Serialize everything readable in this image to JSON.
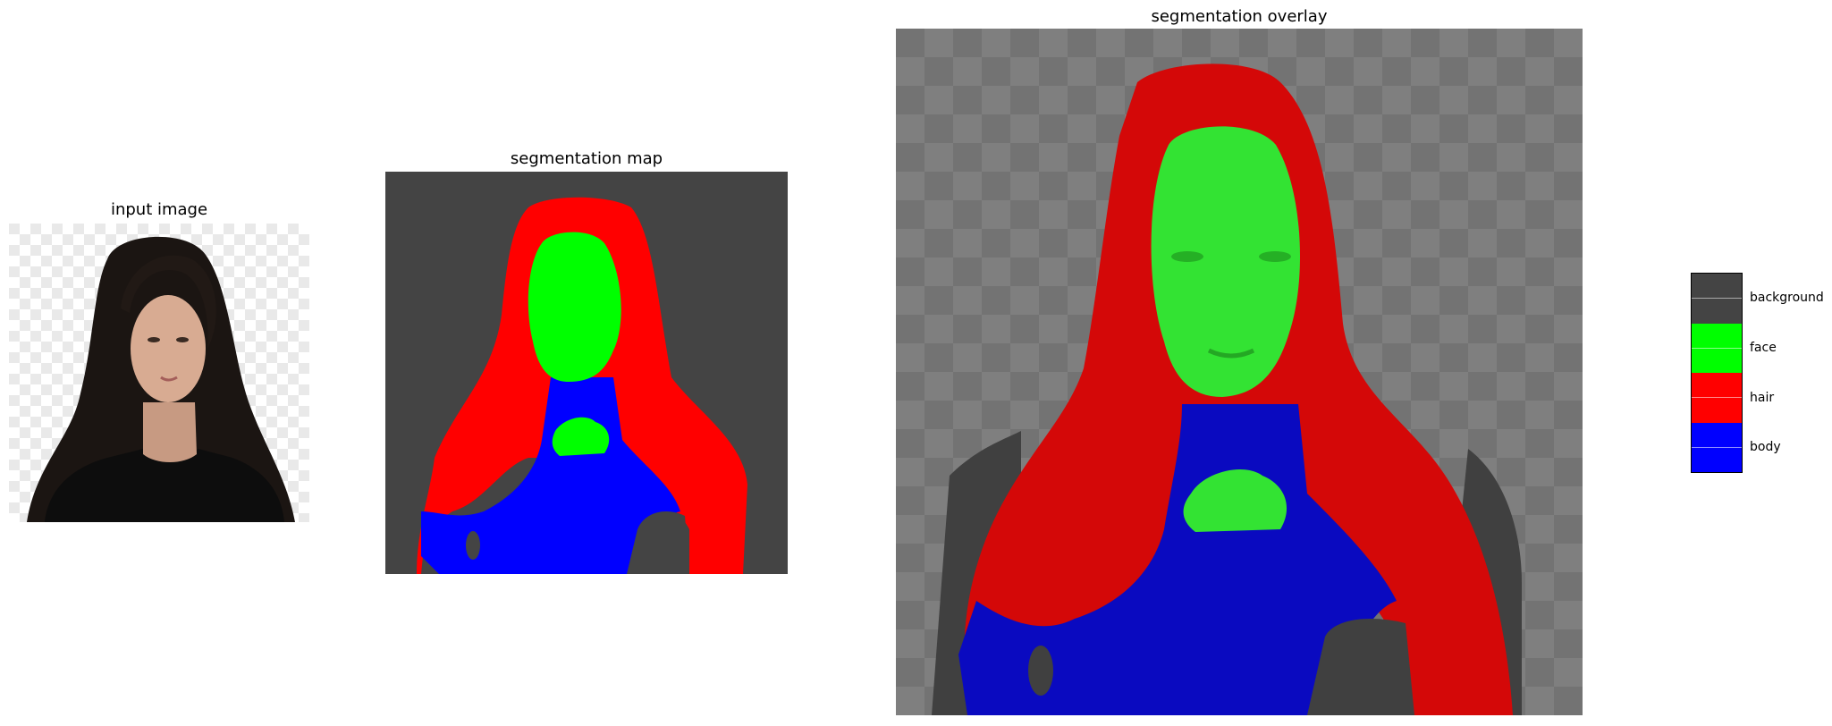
{
  "panels": {
    "input": {
      "title": "input image"
    },
    "map": {
      "title": "segmentation map"
    },
    "overlay": {
      "title": "segmentation overlay"
    }
  },
  "legend": {
    "items": [
      {
        "label": "background",
        "color": "#444444"
      },
      {
        "label": "face",
        "color": "#00ff00"
      },
      {
        "label": "hair",
        "color": "#ff0000"
      },
      {
        "label": "body",
        "color": "#0000ff"
      }
    ]
  }
}
